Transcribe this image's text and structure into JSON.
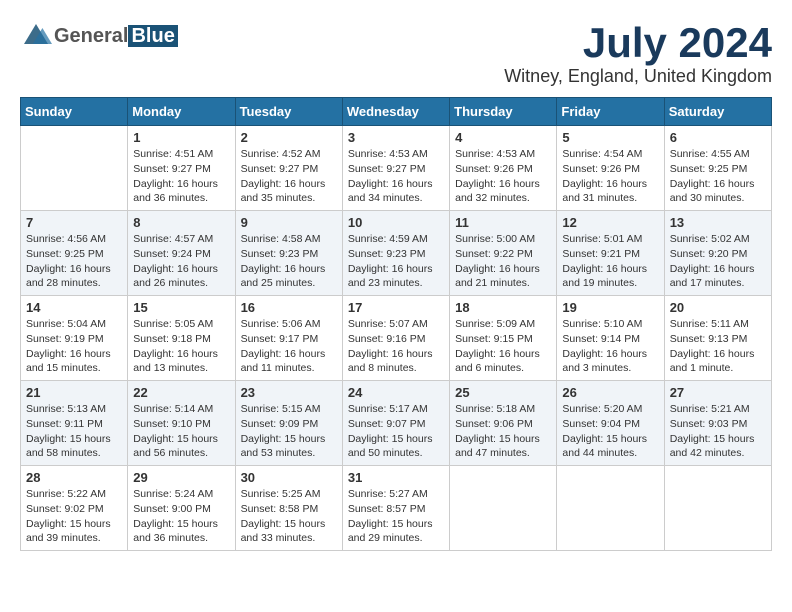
{
  "header": {
    "month": "July 2024",
    "location": "Witney, England, United Kingdom",
    "logo_general": "General",
    "logo_blue": "Blue"
  },
  "weekdays": [
    "Sunday",
    "Monday",
    "Tuesday",
    "Wednesday",
    "Thursday",
    "Friday",
    "Saturday"
  ],
  "weeks": [
    [
      {
        "day": "",
        "info": ""
      },
      {
        "day": "1",
        "info": "Sunrise: 4:51 AM\nSunset: 9:27 PM\nDaylight: 16 hours\nand 36 minutes."
      },
      {
        "day": "2",
        "info": "Sunrise: 4:52 AM\nSunset: 9:27 PM\nDaylight: 16 hours\nand 35 minutes."
      },
      {
        "day": "3",
        "info": "Sunrise: 4:53 AM\nSunset: 9:27 PM\nDaylight: 16 hours\nand 34 minutes."
      },
      {
        "day": "4",
        "info": "Sunrise: 4:53 AM\nSunset: 9:26 PM\nDaylight: 16 hours\nand 32 minutes."
      },
      {
        "day": "5",
        "info": "Sunrise: 4:54 AM\nSunset: 9:26 PM\nDaylight: 16 hours\nand 31 minutes."
      },
      {
        "day": "6",
        "info": "Sunrise: 4:55 AM\nSunset: 9:25 PM\nDaylight: 16 hours\nand 30 minutes."
      }
    ],
    [
      {
        "day": "7",
        "info": "Sunrise: 4:56 AM\nSunset: 9:25 PM\nDaylight: 16 hours\nand 28 minutes."
      },
      {
        "day": "8",
        "info": "Sunrise: 4:57 AM\nSunset: 9:24 PM\nDaylight: 16 hours\nand 26 minutes."
      },
      {
        "day": "9",
        "info": "Sunrise: 4:58 AM\nSunset: 9:23 PM\nDaylight: 16 hours\nand 25 minutes."
      },
      {
        "day": "10",
        "info": "Sunrise: 4:59 AM\nSunset: 9:23 PM\nDaylight: 16 hours\nand 23 minutes."
      },
      {
        "day": "11",
        "info": "Sunrise: 5:00 AM\nSunset: 9:22 PM\nDaylight: 16 hours\nand 21 minutes."
      },
      {
        "day": "12",
        "info": "Sunrise: 5:01 AM\nSunset: 9:21 PM\nDaylight: 16 hours\nand 19 minutes."
      },
      {
        "day": "13",
        "info": "Sunrise: 5:02 AM\nSunset: 9:20 PM\nDaylight: 16 hours\nand 17 minutes."
      }
    ],
    [
      {
        "day": "14",
        "info": "Sunrise: 5:04 AM\nSunset: 9:19 PM\nDaylight: 16 hours\nand 15 minutes."
      },
      {
        "day": "15",
        "info": "Sunrise: 5:05 AM\nSunset: 9:18 PM\nDaylight: 16 hours\nand 13 minutes."
      },
      {
        "day": "16",
        "info": "Sunrise: 5:06 AM\nSunset: 9:17 PM\nDaylight: 16 hours\nand 11 minutes."
      },
      {
        "day": "17",
        "info": "Sunrise: 5:07 AM\nSunset: 9:16 PM\nDaylight: 16 hours\nand 8 minutes."
      },
      {
        "day": "18",
        "info": "Sunrise: 5:09 AM\nSunset: 9:15 PM\nDaylight: 16 hours\nand 6 minutes."
      },
      {
        "day": "19",
        "info": "Sunrise: 5:10 AM\nSunset: 9:14 PM\nDaylight: 16 hours\nand 3 minutes."
      },
      {
        "day": "20",
        "info": "Sunrise: 5:11 AM\nSunset: 9:13 PM\nDaylight: 16 hours\nand 1 minute."
      }
    ],
    [
      {
        "day": "21",
        "info": "Sunrise: 5:13 AM\nSunset: 9:11 PM\nDaylight: 15 hours\nand 58 minutes."
      },
      {
        "day": "22",
        "info": "Sunrise: 5:14 AM\nSunset: 9:10 PM\nDaylight: 15 hours\nand 56 minutes."
      },
      {
        "day": "23",
        "info": "Sunrise: 5:15 AM\nSunset: 9:09 PM\nDaylight: 15 hours\nand 53 minutes."
      },
      {
        "day": "24",
        "info": "Sunrise: 5:17 AM\nSunset: 9:07 PM\nDaylight: 15 hours\nand 50 minutes."
      },
      {
        "day": "25",
        "info": "Sunrise: 5:18 AM\nSunset: 9:06 PM\nDaylight: 15 hours\nand 47 minutes."
      },
      {
        "day": "26",
        "info": "Sunrise: 5:20 AM\nSunset: 9:04 PM\nDaylight: 15 hours\nand 44 minutes."
      },
      {
        "day": "27",
        "info": "Sunrise: 5:21 AM\nSunset: 9:03 PM\nDaylight: 15 hours\nand 42 minutes."
      }
    ],
    [
      {
        "day": "28",
        "info": "Sunrise: 5:22 AM\nSunset: 9:02 PM\nDaylight: 15 hours\nand 39 minutes."
      },
      {
        "day": "29",
        "info": "Sunrise: 5:24 AM\nSunset: 9:00 PM\nDaylight: 15 hours\nand 36 minutes."
      },
      {
        "day": "30",
        "info": "Sunrise: 5:25 AM\nSunset: 8:58 PM\nDaylight: 15 hours\nand 33 minutes."
      },
      {
        "day": "31",
        "info": "Sunrise: 5:27 AM\nSunset: 8:57 PM\nDaylight: 15 hours\nand 29 minutes."
      },
      {
        "day": "",
        "info": ""
      },
      {
        "day": "",
        "info": ""
      },
      {
        "day": "",
        "info": ""
      }
    ]
  ]
}
